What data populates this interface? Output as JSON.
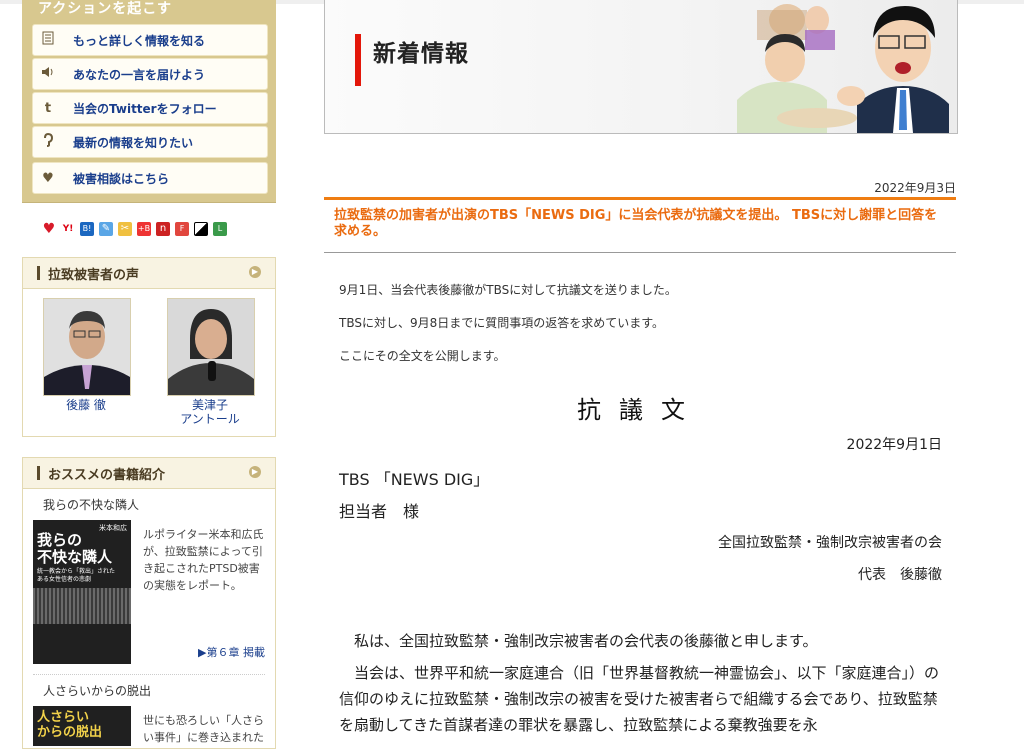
{
  "sidebar": {
    "action_header": "アクションを起こす",
    "action_items": [
      {
        "icon": "document-icon",
        "label": "もっと詳しく情報を知る"
      },
      {
        "icon": "speaker-icon",
        "label": "あなたの一言を届けよう"
      },
      {
        "icon": "twitter-icon",
        "label": "当会のTwitterをフォロー"
      },
      {
        "icon": "ear-icon",
        "label": "最新の情報を知りたい"
      },
      {
        "icon": "heart-icon",
        "label": "被害相談はこちら"
      }
    ],
    "voices": {
      "title": "拉致被害者の声",
      "people": [
        {
          "name": "後藤 徹"
        },
        {
          "name": "美津子\nアントール"
        }
      ]
    },
    "books": {
      "title": "おススメの書籍紹介",
      "items": [
        {
          "title": "我らの不快な隣人",
          "cover_text": "我らの\n不快な隣人",
          "cover_author": "米本和広",
          "cover_sub": "統一教会から「救出」された\nある女性信者の悲劇",
          "desc": "ルポライター米本和広氏が、拉致監禁によって引き起こされたPTSD被害の実態をレポート。",
          "link": "▶第６章 掲載"
        },
        {
          "title": "人さらいからの脱出",
          "cover_text": "人さらい\nからの脱出",
          "desc": "世にも恐ろしい「人さらい事件」に巻き込まれた"
        }
      ]
    }
  },
  "main": {
    "banner_title": "新着情報",
    "date": "2022年9月3日",
    "headline": "拉致監禁の加害者が出演のTBS「NEWS DIG」に当会代表が抗議文を提出。 TBSに対し謝罪と回答を求める。",
    "paragraphs": [
      "9月1日、当会代表後藤徹がTBSに対して抗議文を送りました。",
      "TBSに対し、9月8日までに質問事項の返答を求めています。",
      "ここにその全文を公開します。"
    ],
    "protest_title": "抗議文",
    "letter_date": "2022年9月1日",
    "recipient": "TBS 「NEWS DIG」",
    "recipient_person": "担当者　様",
    "sender_org": "全国拉致監禁・強制改宗被害者の会",
    "sender_person": "代表　後藤徹",
    "letter_paragraphs": [
      "私は、全国拉致監禁・強制改宗被害者の会代表の後藤徹と申します。",
      "当会は、世界平和統一家庭連合（旧「世界基督教統一神霊協会」、以下「家庭連合」）の信仰のゆえに拉致監禁・強制改宗の被害を受けた被害者らで組織する会であり、拉致監禁を扇動してきた首謀者達の罪状を暴露し、拉致監禁による棄教強要を永"
    ]
  },
  "colors": {
    "accent_orange": "#ef7d12",
    "banner_red": "#e3170a",
    "sidebar_gold": "#d8c88f",
    "link_blue": "#1a3e8c"
  }
}
